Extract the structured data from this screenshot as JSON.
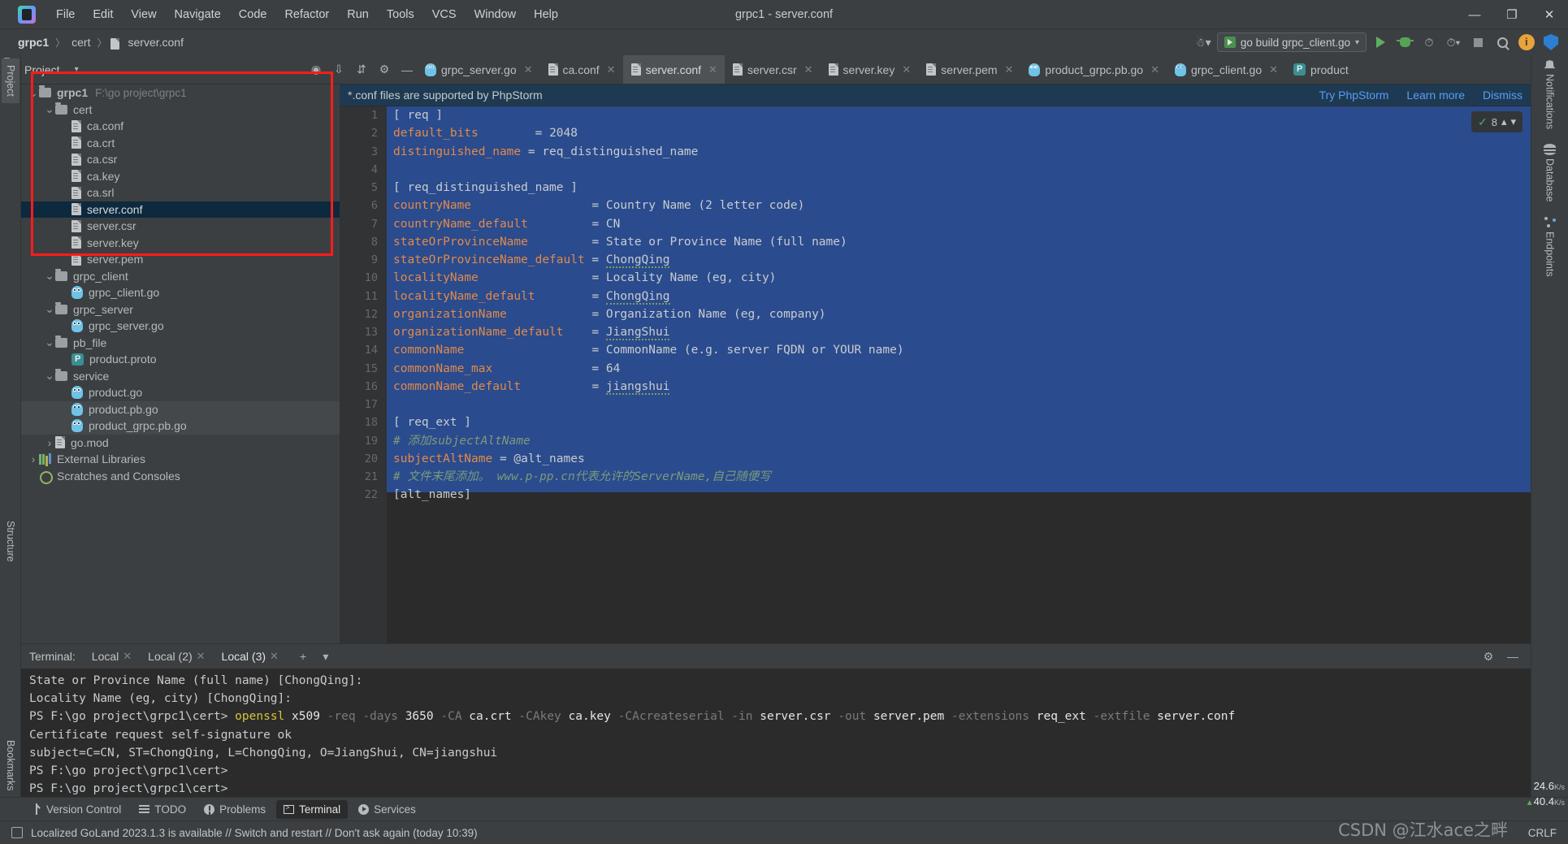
{
  "window": {
    "title": "grpc1 - server.conf",
    "app_icon": "goland-logo-icon",
    "minimize": "—",
    "maximize": "❐",
    "close": "✕"
  },
  "menu": [
    "File",
    "Edit",
    "View",
    "Navigate",
    "Code",
    "Refactor",
    "Run",
    "Tools",
    "VCS",
    "Window",
    "Help"
  ],
  "breadcrumb": {
    "project": "grpc1",
    "folder": "cert",
    "file": "server.conf",
    "separator": "〉"
  },
  "run_toolbar": {
    "config_name": "go build grpc_client.go",
    "profile_icon": "user-profile-icon",
    "run_icon": "run-icon",
    "debug_icon": "debug-icon",
    "coverage_icon": "run-with-coverage-icon",
    "profiler_icon": "run-with-profiler-icon",
    "stop_icon": "stop-icon",
    "search_icon": "search-everywhere-icon",
    "updates_icon": "ide-update-icon",
    "feedback_icon": "feedback-icon"
  },
  "project_panel": {
    "title": "Project",
    "dropdown_icon": "chevron-down-icon",
    "actions": [
      "target-icon",
      "collapse-all-icon",
      "expand-all-icon",
      "settings-gear-icon",
      "hide-icon"
    ]
  },
  "tree": [
    {
      "label": "grpc1",
      "path": "F:\\go project\\grpc1",
      "depth": 0,
      "type": "folder",
      "twisty": "v",
      "state": "partial"
    },
    {
      "label": "cert",
      "depth": 1,
      "type": "folder",
      "twisty": "v"
    },
    {
      "label": "ca.conf",
      "depth": 2,
      "type": "conf"
    },
    {
      "label": "ca.crt",
      "depth": 2,
      "type": "conf"
    },
    {
      "label": "ca.csr",
      "depth": 2,
      "type": "conf"
    },
    {
      "label": "ca.key",
      "depth": 2,
      "type": "conf"
    },
    {
      "label": "ca.srl",
      "depth": 2,
      "type": "conf"
    },
    {
      "label": "server.conf",
      "depth": 2,
      "type": "conf",
      "selected": true
    },
    {
      "label": "server.csr",
      "depth": 2,
      "type": "conf"
    },
    {
      "label": "server.key",
      "depth": 2,
      "type": "conf"
    },
    {
      "label": "server.pem",
      "depth": 2,
      "type": "conf"
    },
    {
      "label": "grpc_client",
      "depth": 1,
      "type": "folder",
      "twisty": "v"
    },
    {
      "label": "grpc_client.go",
      "depth": 2,
      "type": "go"
    },
    {
      "label": "grpc_server",
      "depth": 1,
      "type": "folder",
      "twisty": "v"
    },
    {
      "label": "grpc_server.go",
      "depth": 2,
      "type": "go"
    },
    {
      "label": "pb_file",
      "depth": 1,
      "type": "folder",
      "twisty": "v"
    },
    {
      "label": "product.proto",
      "depth": 2,
      "type": "proto"
    },
    {
      "label": "service",
      "depth": 1,
      "type": "folder",
      "twisty": "v"
    },
    {
      "label": "product.go",
      "depth": 2,
      "type": "go"
    },
    {
      "label": "product.pb.go",
      "depth": 2,
      "type": "go",
      "highlight": true
    },
    {
      "label": "product_grpc.pb.go",
      "depth": 2,
      "type": "go",
      "highlight": true
    },
    {
      "label": "go.mod",
      "depth": 1,
      "type": "conf",
      "twisty": ">"
    },
    {
      "label": "External Libraries",
      "depth": 0,
      "type": "lib",
      "twisty": ">"
    },
    {
      "label": "Scratches and Consoles",
      "depth": 0,
      "type": "scratch"
    }
  ],
  "editor_tabs": [
    {
      "label": "grpc_server.go",
      "icon": "go",
      "active": false
    },
    {
      "label": "ca.conf",
      "icon": "conf",
      "active": false
    },
    {
      "label": "server.conf",
      "icon": "conf",
      "active": true
    },
    {
      "label": "server.csr",
      "icon": "conf",
      "active": false
    },
    {
      "label": "server.key",
      "icon": "conf",
      "active": false
    },
    {
      "label": "server.pem",
      "icon": "conf",
      "active": false
    },
    {
      "label": "product_grpc.pb.go",
      "icon": "go",
      "active": false
    },
    {
      "label": "grpc_client.go",
      "icon": "go",
      "active": false
    },
    {
      "label": "product",
      "icon": "proto",
      "active": false
    }
  ],
  "tab_overflow_icon": "chevron-down-icon",
  "tab_more_icon": "more-vertical-icon",
  "notification": {
    "message": "*.conf files are supported by PhpStorm",
    "actions": [
      "Try PhpStorm",
      "Learn more",
      "Dismiss"
    ]
  },
  "inspection_widget": {
    "count": "8",
    "check_icon": "inspection-ok-icon",
    "up_icon": "chevron-up-icon",
    "down_icon": "chevron-down-icon"
  },
  "code": {
    "lines": [
      {
        "n": 1,
        "text": "[ req ]"
      },
      {
        "n": 2,
        "text": "default_bits        = 2048",
        "key_len": 12
      },
      {
        "n": 3,
        "text": "distinguished_name = req_distinguished_name",
        "key_len": 18
      },
      {
        "n": 4,
        "text": ""
      },
      {
        "n": 5,
        "text": "[ req_distinguished_name ]"
      },
      {
        "n": 6,
        "text": "countryName                 = Country Name (2 letter code)",
        "key_len": 11
      },
      {
        "n": 7,
        "text": "countryName_default         = CN",
        "key_len": 19
      },
      {
        "n": 8,
        "text": "stateOrProvinceName         = State or Province Name (full name)",
        "key_len": 19
      },
      {
        "n": 9,
        "text": "stateOrProvinceName_default = ChongQing",
        "key_len": 27,
        "spell": "ChongQing"
      },
      {
        "n": 10,
        "text": "localityName                = Locality Name (eg, city)",
        "key_len": 12
      },
      {
        "n": 11,
        "text": "localityName_default        = ChongQing",
        "key_len": 20,
        "spell": "ChongQing"
      },
      {
        "n": 12,
        "text": "organizationName            = Organization Name (eg, company)",
        "key_len": 16
      },
      {
        "n": 13,
        "text": "organizationName_default    = JiangShui",
        "key_len": 24,
        "spell": "JiangShui"
      },
      {
        "n": 14,
        "text": "commonName                  = CommonName (e.g. server FQDN or YOUR name)",
        "key_len": 10
      },
      {
        "n": 15,
        "text": "commonName_max              = 64",
        "key_len": 14
      },
      {
        "n": 16,
        "text": "commonName_default          = jiangshui",
        "key_len": 18,
        "spell": "jiangshui"
      },
      {
        "n": 17,
        "text": ""
      },
      {
        "n": 18,
        "text": "[ req_ext ]"
      },
      {
        "n": 19,
        "text": "# 添加subjectAltName",
        "comment": true
      },
      {
        "n": 20,
        "text": "subjectAltName = @alt_names",
        "key_len": 14
      },
      {
        "n": 21,
        "text": "# 文件末尾添加。 www.p-pp.cn代表允许的ServerName,自己随便写",
        "comment": true
      },
      {
        "n": 22,
        "text": "[alt_names]",
        "partial": true
      }
    ]
  },
  "right_strip": [
    {
      "label": "Notifications",
      "icon": "bell-icon"
    },
    {
      "label": "Database",
      "icon": "database-icon"
    },
    {
      "label": "Endpoints",
      "icon": "endpoints-icon"
    }
  ],
  "left_strip": [
    {
      "label": "Project",
      "icon": "project-icon",
      "selected": true
    },
    {
      "label": "Structure",
      "icon": "structure-icon"
    },
    {
      "label": "Bookmarks",
      "icon": "bookmarks-icon"
    }
  ],
  "terminal": {
    "label": "Terminal:",
    "tabs": [
      {
        "label": "Local",
        "active": false
      },
      {
        "label": "Local (2)",
        "active": false
      },
      {
        "label": "Local (3)",
        "active": true
      }
    ],
    "new_tab_icon": "plus-icon",
    "dropdown_icon": "chevron-down-icon",
    "settings_icon": "gear-icon",
    "hide_icon": "minimize-icon",
    "lines": [
      {
        "segments": [
          {
            "t": "State or Province Name (full name) [ChongQing]:",
            "c": "normal"
          }
        ]
      },
      {
        "segments": [
          {
            "t": "Locality Name (eg, city) [ChongQing]:",
            "c": "normal"
          }
        ]
      },
      {
        "segments": [
          {
            "t": "PS F:\\go project\\grpc1\\cert> ",
            "c": "normal"
          },
          {
            "t": "openssl",
            "c": "yellow"
          },
          {
            "t": " x509 ",
            "c": "white"
          },
          {
            "t": "-req -days ",
            "c": "dim"
          },
          {
            "t": "3650",
            "c": "white"
          },
          {
            "t": " -CA ",
            "c": "dim"
          },
          {
            "t": "ca.crt",
            "c": "white"
          },
          {
            "t": " -CAkey ",
            "c": "dim"
          },
          {
            "t": "ca.key",
            "c": "white"
          },
          {
            "t": " -CAcreateserial -in ",
            "c": "dim"
          },
          {
            "t": "server.csr",
            "c": "white"
          },
          {
            "t": " -out ",
            "c": "dim"
          },
          {
            "t": "server.pem",
            "c": "white"
          },
          {
            "t": " -extensions ",
            "c": "dim"
          },
          {
            "t": "req_ext",
            "c": "white"
          },
          {
            "t": " -extfile ",
            "c": "dim"
          },
          {
            "t": "server.conf",
            "c": "white"
          }
        ]
      },
      {
        "segments": [
          {
            "t": "Certificate request self-signature ok",
            "c": "normal"
          }
        ]
      },
      {
        "segments": [
          {
            "t": "subject=C=CN, ST=ChongQing, L=ChongQing, O=JiangShui, CN=jiangshui",
            "c": "normal"
          }
        ]
      },
      {
        "segments": [
          {
            "t": "PS F:\\go project\\grpc1\\cert>",
            "c": "normal"
          }
        ]
      },
      {
        "segments": [
          {
            "t": "PS F:\\go project\\grpc1\\cert>",
            "c": "normal"
          }
        ]
      }
    ]
  },
  "tool_window_bar": [
    {
      "label": "Version Control",
      "icon": "version-control-icon",
      "active": false
    },
    {
      "label": "TODO",
      "icon": "todo-icon",
      "active": false
    },
    {
      "label": "Problems",
      "icon": "problems-icon",
      "active": false
    },
    {
      "label": "Terminal",
      "icon": "terminal-icon",
      "active": true
    },
    {
      "label": "Services",
      "icon": "services-icon",
      "active": false
    }
  ],
  "status_bar": {
    "icon": "ide-message-icon",
    "message": "Localized GoLand 2023.1.3 is available // Switch and restart // Don't ask again (today 10:39)",
    "line_separator": "CRLF",
    "watermark": "CSDN @江水ace之畔"
  },
  "net_monitor": {
    "down_value": "24.6",
    "down_unit": "K/s",
    "up_value": "40.4",
    "up_unit": "K/s",
    "up_arrow": "▲"
  },
  "colors": {
    "background": "#3c3f41",
    "editor_bg": "#2b2b2b",
    "selection_blue": "#2a4b8d",
    "accent_link": "#589df6",
    "annotation_red": "#fd1c1c",
    "tree_selected": "#0d293e",
    "keyword_orange": "#e08a4c",
    "comment_green": "#7d9a7d"
  }
}
